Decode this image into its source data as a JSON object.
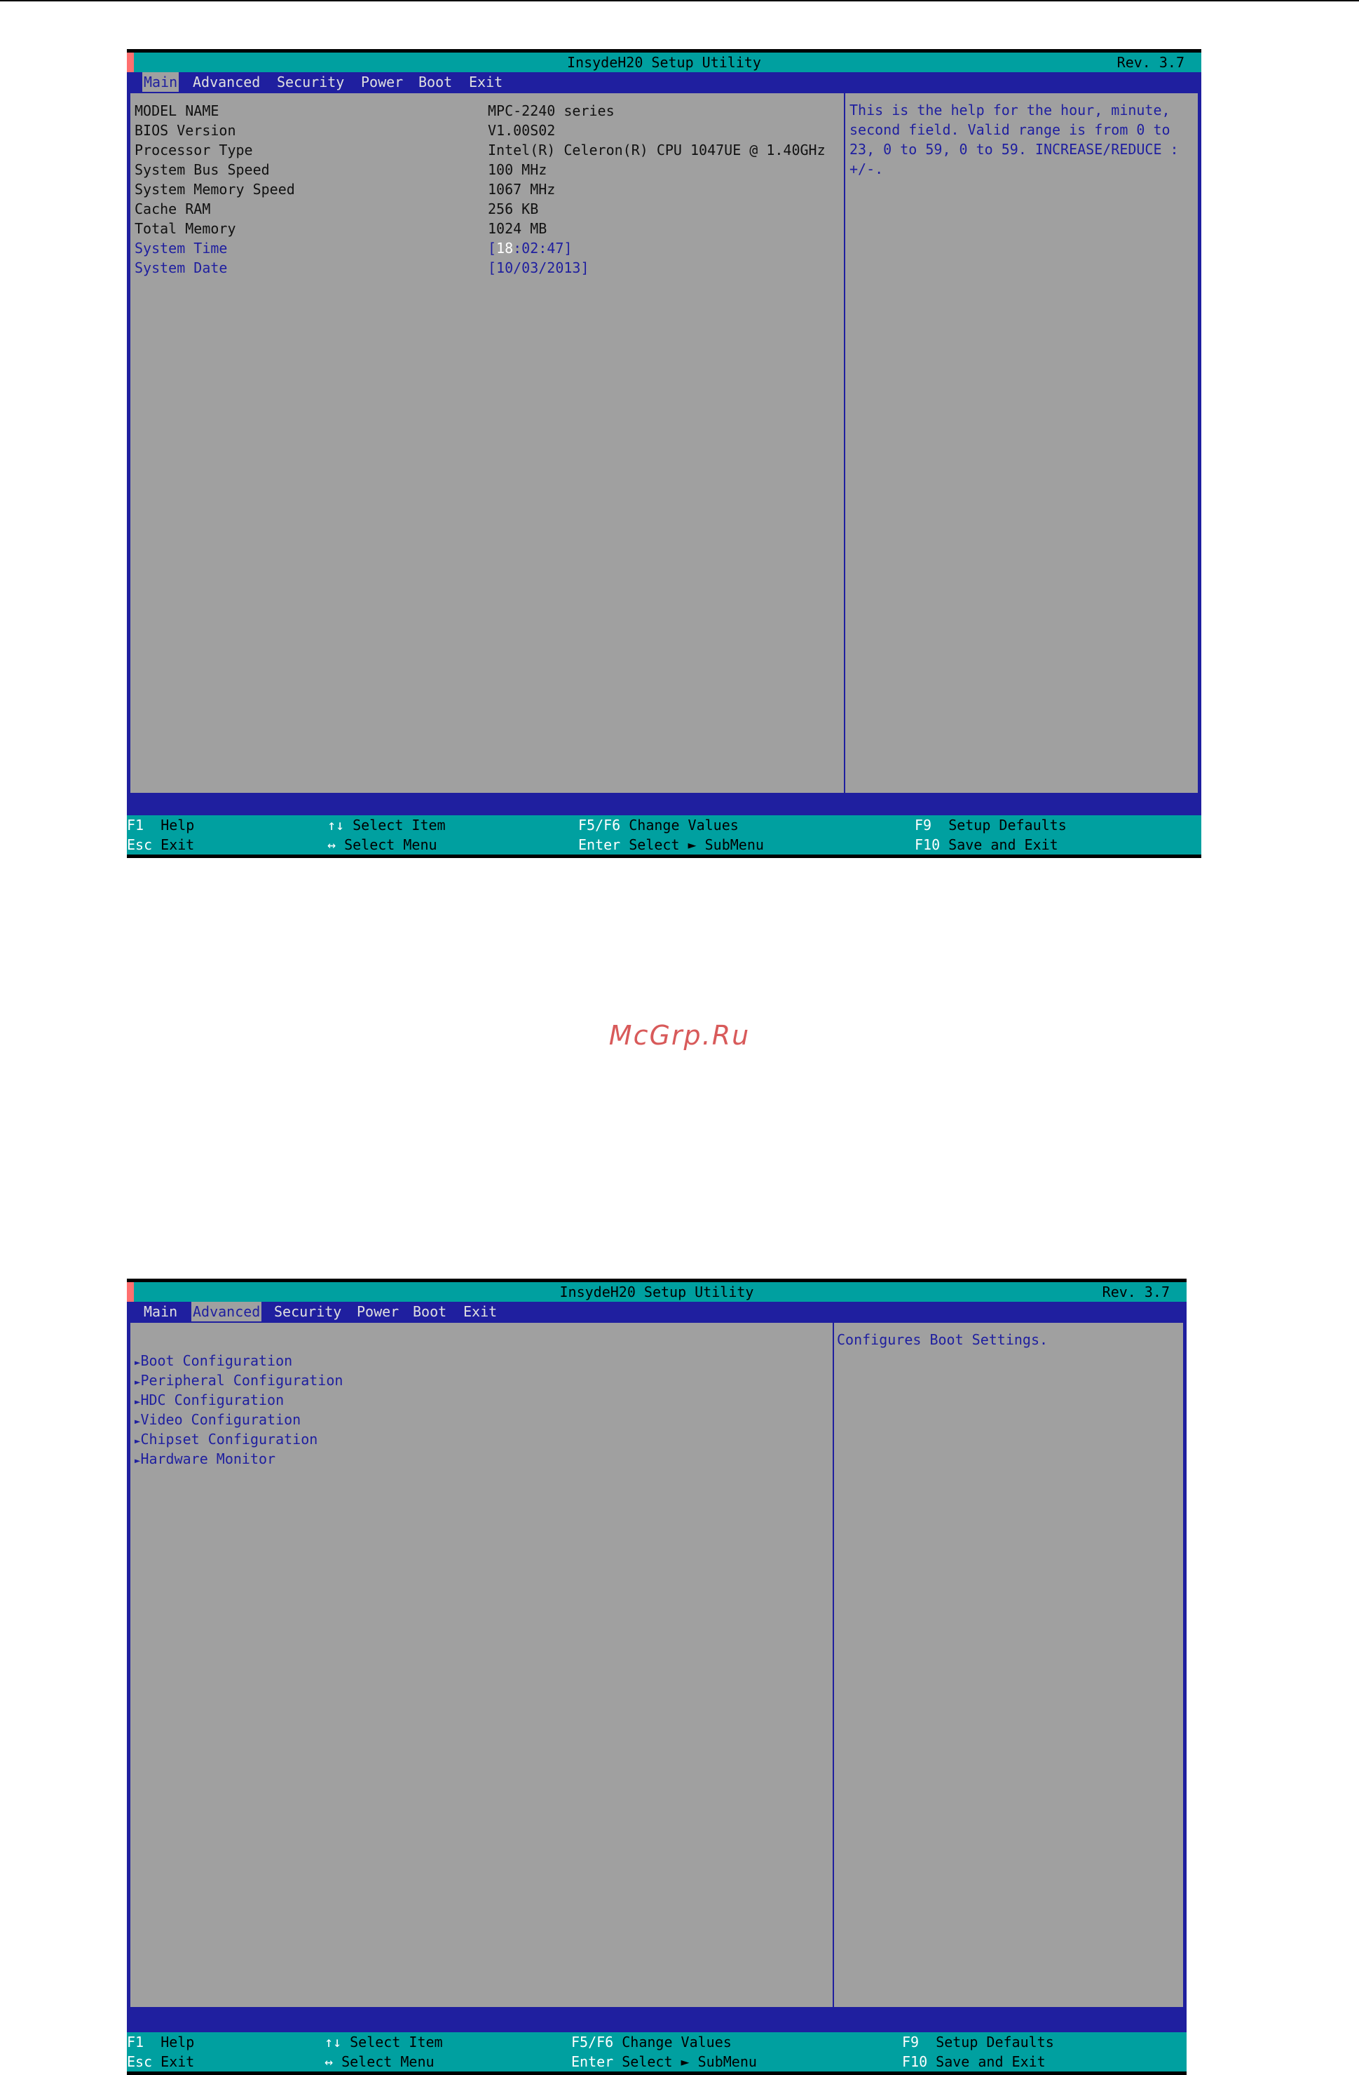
{
  "screen1": {
    "title": "InsydeH20 Setup Utility",
    "rev": "Rev. 3.7",
    "menu": [
      {
        "label": "Main",
        "active": true
      },
      {
        "label": "Advanced"
      },
      {
        "label": "Security"
      },
      {
        "label": "Power"
      },
      {
        "label": "Boot"
      },
      {
        "label": "Exit"
      }
    ],
    "rows": [
      {
        "label": "MODEL NAME",
        "value": "MPC-2240 series"
      },
      {
        "label": "BIOS Version",
        "value": "V1.00S02"
      },
      {
        "label": "Processor Type",
        "value": "Intel(R) Celeron(R) CPU 1047UE @ 1.40GHz"
      },
      {
        "label": "System Bus Speed",
        "value": "100 MHz"
      },
      {
        "label": "System Memory Speed",
        "value": "1067 MHz"
      },
      {
        "label": "Cache RAM",
        "value": "256 KB"
      },
      {
        "label": "Total Memory",
        "value": "1024 MB"
      },
      {
        "label": "System Time",
        "value_pre": "[",
        "value_hl": "18",
        "value_post": ":02:47]"
      },
      {
        "label": "System Date",
        "value": "[10/03/2013]"
      }
    ],
    "help": "This is the help for the hour, minute, second field. Valid range is from 0 to 23, 0 to 59, 0 to 59. INCREASE/REDUCE : +/-."
  },
  "screen2": {
    "title": "InsydeH20 Setup Utility",
    "rev": "Rev. 3.7",
    "menu": [
      {
        "label": "Main"
      },
      {
        "label": "Advanced",
        "active": true
      },
      {
        "label": "Security"
      },
      {
        "label": "Power"
      },
      {
        "label": "Boot"
      },
      {
        "label": "Exit"
      }
    ],
    "submenus": [
      "Boot Configuration",
      "Peripheral Configuration",
      "HDC Configuration",
      "Video Configuration",
      "Chipset Configuration",
      "Hardware Monitor"
    ],
    "help": "Configures Boot Settings."
  },
  "footer": {
    "f1_key": "F1",
    "f1_label": "Help",
    "esc_key": "Esc",
    "esc_label": "Exit",
    "updown_key": "↑↓",
    "updown_label": "Select Item",
    "leftright_key": "↔",
    "leftright_label": "Select Menu",
    "f5f6_key": "F5/F6",
    "f5f6_label": "Change Values",
    "enter_key": "Enter",
    "enter_label": "Select ► SubMenu",
    "f9_key": "F9",
    "f9_label": "Setup Defaults",
    "f10_key": "F10",
    "f10_label": "Save and Exit"
  },
  "watermark": "McGrp.Ru",
  "colors": {
    "bios_blue": "#1f1f9f",
    "bios_cyan": "#00a0a0",
    "bios_gray": "#a0a0a0",
    "accent_red": "#ff6f6f"
  }
}
